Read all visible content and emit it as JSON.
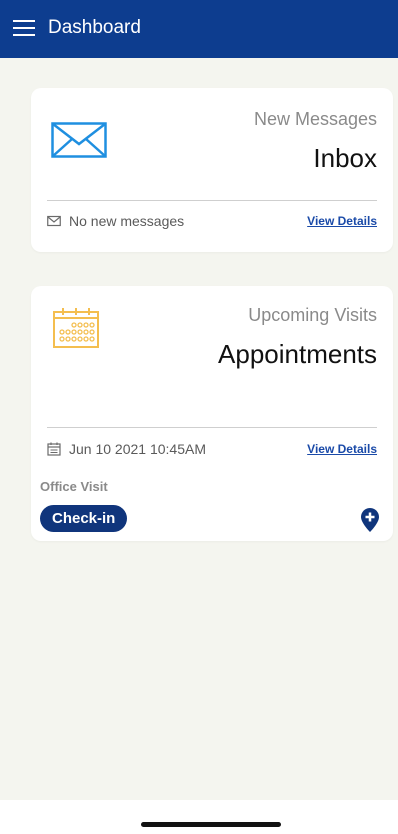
{
  "app_bar": {
    "title": "Dashboard",
    "background": "#0d3d8f",
    "menu_icon": "hamburger-menu-icon"
  },
  "inbox_card": {
    "subtitle": "New Messages",
    "title": "Inbox",
    "icon": "envelope-icon",
    "status_icon": "envelope-icon",
    "status_text": "No new messages",
    "view_details_label": "View Details"
  },
  "appointments_card": {
    "subtitle": "Upcoming Visits",
    "title": "Appointments",
    "icon": "calendar-icon",
    "date_icon": "calendar-icon",
    "date_text": "Jun 10 2021 10:45AM",
    "view_details_label": "View Details",
    "visit_type": "Office Visit",
    "checkin_label": "Check-in",
    "location_icon": "location-pin-icon"
  },
  "colors": {
    "accent": "#0d3d8f",
    "link": "#1a4aa8",
    "calendar": "#f4be4f",
    "background": "#f4f5ef"
  }
}
